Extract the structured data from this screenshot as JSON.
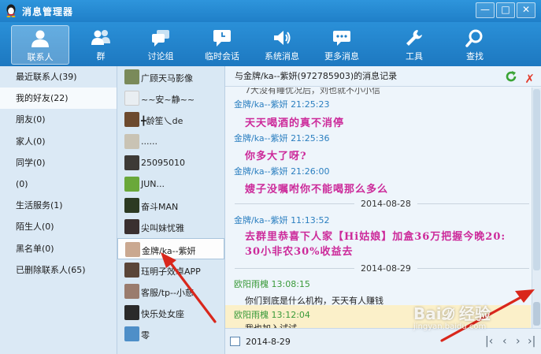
{
  "window": {
    "title": "消息管理器"
  },
  "toolbar": {
    "items": [
      {
        "label": "联系人",
        "icon": "person-icon"
      },
      {
        "label": "群",
        "icon": "group-icon"
      },
      {
        "label": "讨论组",
        "icon": "discussion-icon"
      },
      {
        "label": "临时会话",
        "icon": "temp-chat-icon"
      },
      {
        "label": "系统消息",
        "icon": "speaker-icon"
      },
      {
        "label": "更多消息",
        "icon": "more-messages-icon"
      },
      {
        "label": "工具",
        "icon": "wrench-icon"
      },
      {
        "label": "查找",
        "icon": "search-icon"
      }
    ]
  },
  "categories": [
    {
      "label": "最近联系人(39)"
    },
    {
      "label": "我的好友(22)"
    },
    {
      "label": "朋友(0)"
    },
    {
      "label": "家人(0)"
    },
    {
      "label": "同学(0)"
    },
    {
      "label": "(0)"
    },
    {
      "label": "生活服务(1)"
    },
    {
      "label": "陌生人(0)"
    },
    {
      "label": "黑名单(0)"
    },
    {
      "label": "已删除联系人(65)"
    }
  ],
  "friends": [
    {
      "name": "广顾天马影像",
      "color": "#7a8a5a"
    },
    {
      "name": "~~安~静~~",
      "color": "#e9eef2"
    },
    {
      "name": "╋龄笙乀de",
      "color": "#6d4a2e"
    },
    {
      "name": "......",
      "color": "#c9c3b4"
    },
    {
      "name": "25095010",
      "color": "#3d3a36"
    },
    {
      "name": "JUN...",
      "color": "#6aa83a"
    },
    {
      "name": "奋斗MAN",
      "color": "#2c3a22"
    },
    {
      "name": "尖叫妹忧雅",
      "color": "#3a3030"
    },
    {
      "name": "金牌/ka--紫妍",
      "color": "#caa890"
    },
    {
      "name": "珏明子效卓APP",
      "color": "#5a4538"
    },
    {
      "name": "客服/tp--小慈",
      "color": "#9a7c6e"
    },
    {
      "name": "快乐处女座",
      "color": "#2a2a2a"
    },
    {
      "name": "零",
      "color": "#4e8fc8"
    }
  ],
  "messages": {
    "header": "与金牌/ka--紫妍(972785903)的消息记录",
    "top_partial": "7大没有睡优况后，刘也就不小小信",
    "items": [
      {
        "sender": "金牌/ka--紫妍",
        "time": "21:25:23",
        "body": "天天喝酒的真不消停"
      },
      {
        "sender": "金牌/ka--紫妍",
        "time": "21:25:36",
        "body": "你多大了呀?"
      },
      {
        "sender": "金牌/ka--紫妍",
        "time": "21:26:00",
        "body": "嫂子没嘱咐你不能喝那么多么"
      },
      {
        "date": "2014-08-28"
      },
      {
        "sender": "金牌/ka--紫妍",
        "time": "11:13:52",
        "body": "去群里恭喜下人家【Hi姑娘】加盒36万把握今晚20: 30小非农30%收益去"
      },
      {
        "date": "2014-08-29"
      },
      {
        "sender": "欧阳雨槐",
        "time": "13:08:15",
        "body": "你们到底是什么机构，天天有人赚钱"
      },
      {
        "sender": "欧阳雨槐",
        "time": "13:12:04",
        "body": "我也加入试试"
      }
    ],
    "footer_date": "2014-8-29"
  },
  "colors": {
    "accent": "#1f7fc8",
    "sender_other": "#2b7fc0",
    "sender_self": "#3a9a3a",
    "message_highlight": "#cc2a9a"
  },
  "watermark": {
    "text": "Bai𝓓 经验",
    "sub": "jingyan.baidu.com"
  }
}
